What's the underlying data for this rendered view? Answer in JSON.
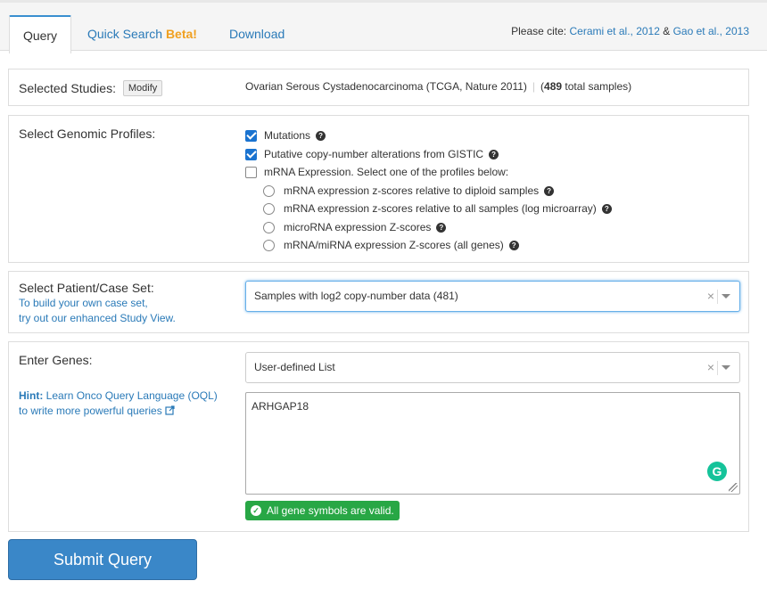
{
  "tabs": {
    "query": "Query",
    "quick_search": "Quick Search",
    "quick_search_beta": "Beta!",
    "download": "Download"
  },
  "cite": {
    "prefix": "Please cite:",
    "ref1": "Cerami et al., 2012",
    "amp": "&",
    "ref2": "Gao et al., 2013"
  },
  "studies": {
    "label": "Selected Studies:",
    "modify": "Modify",
    "name": "Ovarian Serous Cystadenocarcinoma (TCGA, Nature 2011)",
    "count": "489",
    "count_suffix": "total samples)"
  },
  "profiles": {
    "label": "Select Genomic Profiles:",
    "checkboxes": [
      {
        "label": "Mutations",
        "checked": true
      },
      {
        "label": "Putative copy-number alterations from GISTIC",
        "checked": true
      },
      {
        "label": "mRNA Expression. Select one of the profiles below:",
        "checked": false
      }
    ],
    "radios": [
      "mRNA expression z-scores relative to diploid samples",
      "mRNA expression z-scores relative to all samples (log microarray)",
      "microRNA expression Z-scores",
      "mRNA/miRNA expression Z-scores (all genes)"
    ]
  },
  "caseset": {
    "label": "Select Patient/Case Set:",
    "link_line1": "To build your own case set,",
    "link_line2": "try out our enhanced Study View.",
    "selected": "Samples with log2 copy-number data (481)"
  },
  "genes": {
    "label": "Enter Genes:",
    "hint_bold": "Hint:",
    "hint_line1": "Learn Onco Query Language (OQL)",
    "hint_line2": "to write more powerful queries",
    "list_selected": "User-defined List",
    "input_value": "ARHGAP18",
    "valid_message": "All gene symbols are valid."
  },
  "submit_label": "Submit Query",
  "colors": {
    "accent": "#3a87c8",
    "link": "#2a7ab8",
    "valid": "#28a745",
    "beta": "#f0a020"
  }
}
